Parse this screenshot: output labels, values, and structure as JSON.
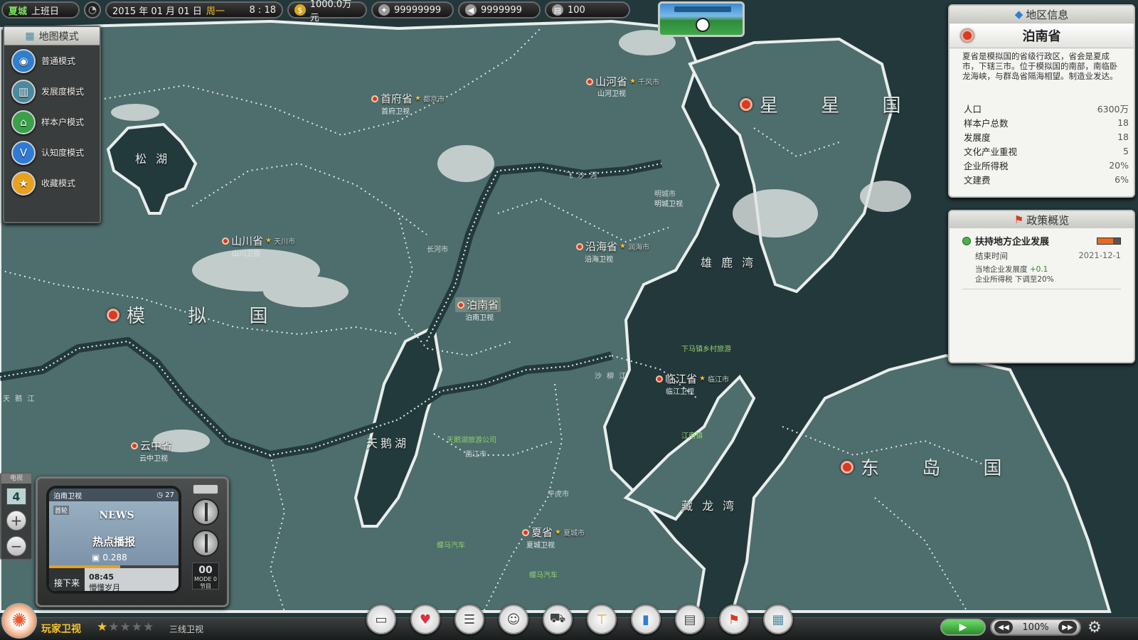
{
  "topbar": {
    "city": "夏城",
    "status": "上班日",
    "date_prefix": "2015 年 01 月 01 日",
    "weekday": "周一",
    "time": "8 : 18",
    "money": "1000.0万元",
    "stat_a": "99999999",
    "stat_b": "9999999",
    "stat_c": "100"
  },
  "mode_panel": {
    "title": "地图模式",
    "items": [
      {
        "label": "普通模式",
        "icon": "map-pin-icon",
        "color": "#2d7fd0"
      },
      {
        "label": "发展度模式",
        "icon": "buildings-icon",
        "color": "#4a8aa0"
      },
      {
        "label": "样本户模式",
        "icon": "sample-house-icon",
        "color": "#3aa04a"
      },
      {
        "label": "认知度模式",
        "icon": "v-badge-icon",
        "color": "#2f7ad6"
      },
      {
        "label": "收藏模式",
        "icon": "star-icon",
        "color": "#e8a020"
      }
    ]
  },
  "region_panel": {
    "header": "地区信息",
    "name": "泊南省",
    "description": "夏省是模拟国的省级行政区，省会是夏成市，下辖三市。位于模拟国的南部，南临卧龙海峡，与群岛省隔海相望。制造业发达。",
    "stats": [
      {
        "label": "人口",
        "value": "6300万"
      },
      {
        "label": "样本户总数",
        "value": "18"
      },
      {
        "label": "发展度",
        "value": "18"
      },
      {
        "label": "文化产业重视",
        "value": "5"
      },
      {
        "label": "企业所得税",
        "value": "20%"
      },
      {
        "label": "文建费",
        "value": "6%"
      }
    ]
  },
  "policy_panel": {
    "header": "政策概览",
    "policy_name": "扶持地方企业发展",
    "end_label": "结束时间",
    "end_date": "2021-12-1",
    "effect1_text": "当地企业发展度",
    "effect1_value": "+0.1",
    "effect2": "企业所得税 下调至20%",
    "progress": 0.7
  },
  "map": {
    "countries": [
      "模 拟 国",
      "星 星 国",
      "东 岛 国"
    ],
    "waters": [
      "松 湖",
      "天鹅湖",
      "雄 鹿 湾",
      "藏 龙 湾"
    ],
    "rivers": [
      "飞 沙 河",
      "天 鹅 江",
      "沙 柳 江"
    ],
    "provinces": [
      {
        "name": "首府省",
        "city": "都京市",
        "tv": "首府卫视"
      },
      {
        "name": "山河省",
        "city": "千风市",
        "tv": "山河卫视"
      },
      {
        "name": "山川省",
        "city": "天川市",
        "tv": "山川卫视"
      },
      {
        "name": "沿海省",
        "city": "润海市",
        "tv": "沿海卫视"
      },
      {
        "name": "泊南省",
        "city": "",
        "tv": "泊南卫视"
      },
      {
        "name": "临江省",
        "city": "临江市",
        "tv": "临江卫视"
      },
      {
        "name": "云中省",
        "city": "",
        "tv": "云中卫视"
      },
      {
        "name": "夏省",
        "city": "夏城市",
        "tv": "夏城卫视"
      }
    ],
    "cities": [
      "长河市",
      "西江市",
      "平虎市",
      "明城市",
      "明城卫视"
    ],
    "pois": [
      "蝶马汽车",
      "蝶马汽车",
      "天鹅湖旅游公司",
      "下马镇乡村旅游",
      "江南镇"
    ]
  },
  "tv": {
    "side_tab": "电视",
    "channel_number": "4",
    "channel_name": "泊南卫视",
    "viewers": "27",
    "tag": "首轮",
    "news": "NEWS",
    "headline": "热点播报",
    "rating": "0.288",
    "next_label": "接下来",
    "next_time": "08:45",
    "next_program": "懵懂岁月",
    "mode_num": "00",
    "mode_label": "MODE 0",
    "mode_sub": "节目",
    "progress": 0.55
  },
  "bottombar": {
    "player_name": "玩家卫视",
    "stars_on": "★",
    "stars_off": "★★★★",
    "tier": "三线卫视",
    "tools": [
      "tv-icon",
      "heart-icon",
      "list-icon",
      "people-icon",
      "cart-icon",
      "crane-icon",
      "bar-chart-icon",
      "newspaper-icon",
      "flag-icon",
      "map-icon"
    ],
    "zoom": "100%"
  }
}
